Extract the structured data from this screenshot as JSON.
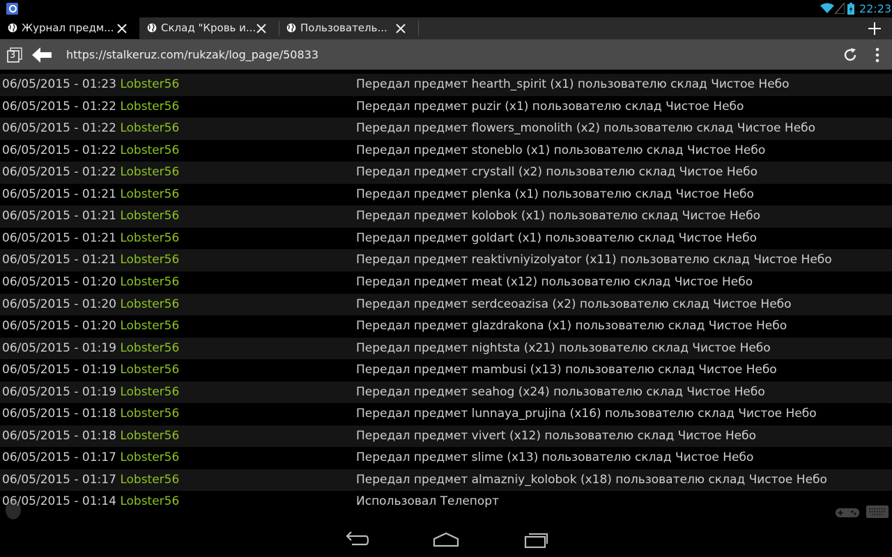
{
  "status": {
    "time": "22:23",
    "accent": "#33b5e5"
  },
  "tabs": [
    {
      "title": "Журнал предм..."
    },
    {
      "title": "Склад \"Кровь и..."
    },
    {
      "title": "Пользователь..."
    }
  ],
  "urlbar": {
    "tab_count": "3",
    "url": "https://stalkeruz.com/rukzak/log_page/50833"
  },
  "colors": {
    "user": "#8ec41f",
    "text": "#d0d0d0"
  },
  "log": [
    {
      "date": "06/05/2015 - 01:23",
      "user": "Lobster56",
      "message": "Передал предмет hearth_spirit (x1) пользователю склад Чистое Небо"
    },
    {
      "date": "06/05/2015 - 01:22",
      "user": "Lobster56",
      "message": "Передал предмет puzir (x1) пользователю склад Чистое Небо"
    },
    {
      "date": "06/05/2015 - 01:22",
      "user": "Lobster56",
      "message": "Передал предмет flowers_monolith (x2) пользователю склад Чистое Небо"
    },
    {
      "date": "06/05/2015 - 01:22",
      "user": "Lobster56",
      "message": "Передал предмет stoneblo (x1) пользователю склад Чистое Небо"
    },
    {
      "date": "06/05/2015 - 01:22",
      "user": "Lobster56",
      "message": "Передал предмет crystall (x2) пользователю склад Чистое Небо"
    },
    {
      "date": "06/05/2015 - 01:21",
      "user": "Lobster56",
      "message": "Передал предмет plenka (x1) пользователю склад Чистое Небо"
    },
    {
      "date": "06/05/2015 - 01:21",
      "user": "Lobster56",
      "message": "Передал предмет kolobok (x1) пользователю склад Чистое Небо"
    },
    {
      "date": "06/05/2015 - 01:21",
      "user": "Lobster56",
      "message": "Передал предмет goldart (x1) пользователю склад Чистое Небо"
    },
    {
      "date": "06/05/2015 - 01:21",
      "user": "Lobster56",
      "message": "Передал предмет reaktivniyizolyator (x11) пользователю склад Чистое Небо"
    },
    {
      "date": "06/05/2015 - 01:20",
      "user": "Lobster56",
      "message": "Передал предмет meat (x12) пользователю склад Чистое Небо"
    },
    {
      "date": "06/05/2015 - 01:20",
      "user": "Lobster56",
      "message": "Передал предмет serdceoazisa (x2) пользователю склад Чистое Небо"
    },
    {
      "date": "06/05/2015 - 01:20",
      "user": "Lobster56",
      "message": "Передал предмет glazdrakona (x1) пользователю склад Чистое Небо"
    },
    {
      "date": "06/05/2015 - 01:19",
      "user": "Lobster56",
      "message": "Передал предмет nightsta (x21) пользователю склад Чистое Небо"
    },
    {
      "date": "06/05/2015 - 01:19",
      "user": "Lobster56",
      "message": "Передал предмет mambusi (x13) пользователю склад Чистое Небо"
    },
    {
      "date": "06/05/2015 - 01:19",
      "user": "Lobster56",
      "message": "Передал предмет seahog (x24) пользователю склад Чистое Небо"
    },
    {
      "date": "06/05/2015 - 01:18",
      "user": "Lobster56",
      "message": "Передал предмет lunnaya_prujina (x16) пользователю склад Чистое Небо"
    },
    {
      "date": "06/05/2015 - 01:18",
      "user": "Lobster56",
      "message": "Передал предмет vivert (x12) пользователю склад Чистое Небо"
    },
    {
      "date": "06/05/2015 - 01:17",
      "user": "Lobster56",
      "message": "Передал предмет slime (x13) пользователю склад Чистое Небо"
    },
    {
      "date": "06/05/2015 - 01:17",
      "user": "Lobster56",
      "message": "Передал предмет almazniy_kolobok (x18) пользователю склад Чистое Небо"
    },
    {
      "date": "06/05/2015 - 01:14",
      "user": "Lobster56",
      "message": "Использовал Телепорт"
    }
  ]
}
